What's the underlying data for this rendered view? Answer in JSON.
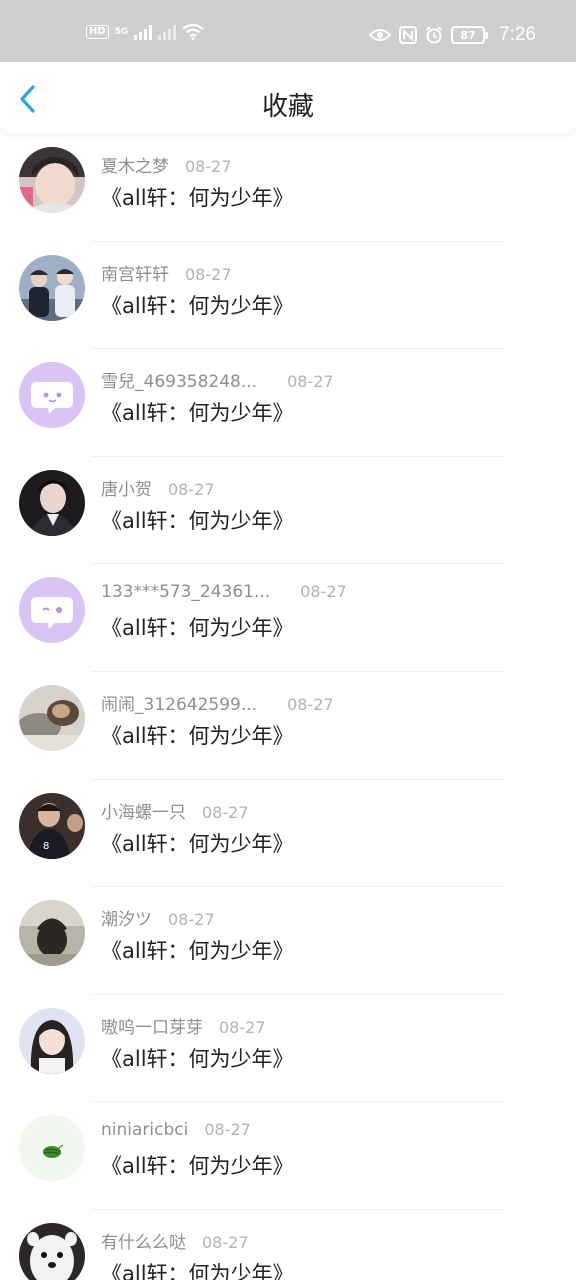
{
  "status_bar": {
    "hd": "HD",
    "network": "5G",
    "battery": "87",
    "time": "7:26"
  },
  "header": {
    "title": "收藏"
  },
  "items": [
    {
      "name": "夏木之梦",
      "date": "08-27",
      "work": "《all轩：何为少年》",
      "avatar": "photo-boy"
    },
    {
      "name": "南宫轩轩",
      "date": "08-27",
      "work": "《all轩：何为少年》",
      "avatar": "photo-duo"
    },
    {
      "name": "雪兒_469358248...",
      "date": "08-27",
      "work": "《all轩：何为少年》",
      "avatar": "default-chat"
    },
    {
      "name": "唐小贺",
      "date": "08-27",
      "work": "《all轩：何为少年》",
      "avatar": "photo-dark"
    },
    {
      "name": "133***573_24361...",
      "date": "08-27",
      "work": "《all轩：何为少年》",
      "avatar": "default-chat"
    },
    {
      "name": "闹闹_312642599...",
      "date": "08-27",
      "work": "《all轩：何为少年》",
      "avatar": "photo-cat"
    },
    {
      "name": "小海螺一只",
      "date": "08-27",
      "work": "《all轩：何为少年》",
      "avatar": "photo-team"
    },
    {
      "name": "潮汐ツ",
      "date": "08-27",
      "work": "《all轩：何为少年》",
      "avatar": "photo-heart"
    },
    {
      "name": "嗷呜一口芽芽",
      "date": "08-27",
      "work": "《all轩：何为少年》",
      "avatar": "photo-girl"
    },
    {
      "name": "niniaricbci",
      "date": "08-27",
      "work": "《all轩：何为少年》",
      "avatar": "watermelon"
    },
    {
      "name": "有什么么哒",
      "date": "08-27",
      "work": "《all轩：何为少年》",
      "avatar": "photo-animal"
    }
  ],
  "colors": {
    "accent": "#2aa7e0",
    "default_avatar_bg": "#d9c4f5"
  }
}
